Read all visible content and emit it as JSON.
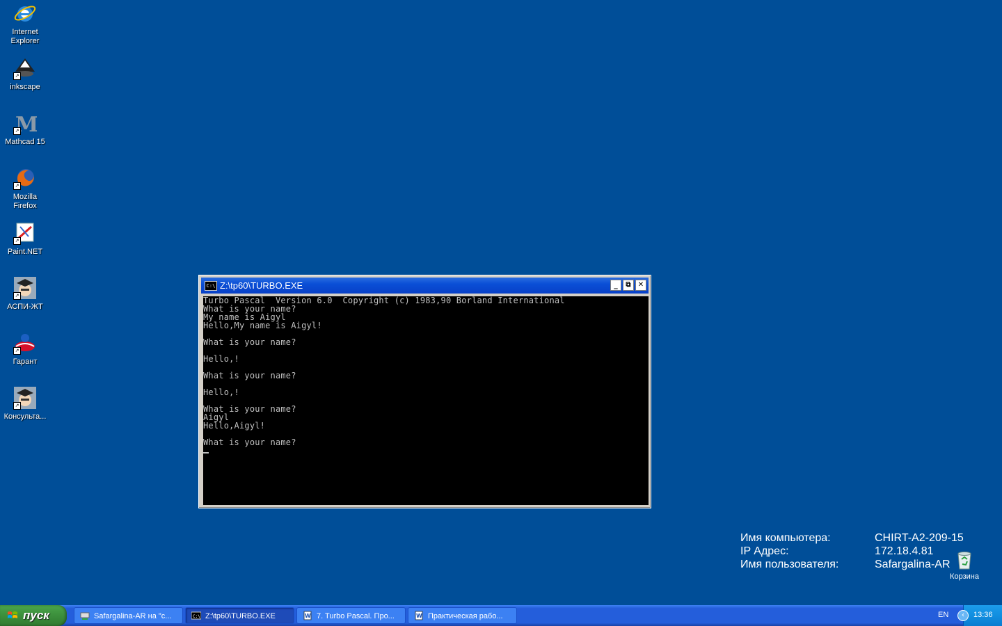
{
  "desktop": {
    "icons": [
      {
        "label": "Internet Explorer",
        "icon": "internet-explorer-icon"
      },
      {
        "label": "inkscape",
        "icon": "inkscape-icon"
      },
      {
        "label": "Mathcad 15",
        "icon": "mathcad-icon"
      },
      {
        "label": "Mozilla Firefox",
        "icon": "firefox-icon"
      },
      {
        "label": "Paint.NET",
        "icon": "paintnet-icon"
      },
      {
        "label": "АСПИ-ЖТ",
        "icon": "aspi-icon"
      },
      {
        "label": "Гарант",
        "icon": "garant-icon"
      },
      {
        "label": "Консульта...",
        "icon": "consultant-icon"
      }
    ],
    "recycle_bin": {
      "label": "Корзина"
    }
  },
  "console": {
    "title": "Z:\\tp60\\TURBO.EXE",
    "title_icon": "C:\\",
    "buttons": {
      "minimize": "_",
      "restore": "⧉",
      "close": "✕"
    },
    "lines": [
      "Turbo Pascal  Version 6.0  Copyright (c) 1983,90 Borland International",
      "What is your name?",
      "My name is Aigyl",
      "Hello,My name is Aigyl!",
      "",
      "What is your name?",
      "",
      "Hello,!",
      "",
      "What is your name?",
      "",
      "Hello,!",
      "",
      "What is your name?",
      "Aigyl",
      "Hello,Aigyl!",
      "",
      "What is your name?"
    ]
  },
  "bginfo": {
    "rows": [
      {
        "key": "Имя компьютера:",
        "value": "CHIRT-A2-209-15"
      },
      {
        "key": "IP Адрес:",
        "value": "172.18.4.81"
      },
      {
        "key": "Имя пользователя:",
        "value": "Safargalina-AR"
      }
    ]
  },
  "taskbar": {
    "start_label": "пуск",
    "tasks": [
      {
        "label": "Safargalina-AR на \"с...",
        "icon": "network-drive-icon",
        "active": false
      },
      {
        "label": "Z:\\tp60\\TURBO.EXE",
        "icon": "console-icon",
        "active": true
      },
      {
        "label": "7. Turbo Pascal. Про...",
        "icon": "word-document-icon",
        "active": false
      },
      {
        "label": "Практическая рабо...",
        "icon": "word-document-icon",
        "active": false
      }
    ],
    "language": "EN",
    "clock": "13:36"
  },
  "colors": {
    "desktop_bg": "#004e98",
    "taskbar": "#245edb",
    "start_button": "#3c8f3c",
    "console_bg": "#000000",
    "console_fg": "#c0c0c0"
  }
}
